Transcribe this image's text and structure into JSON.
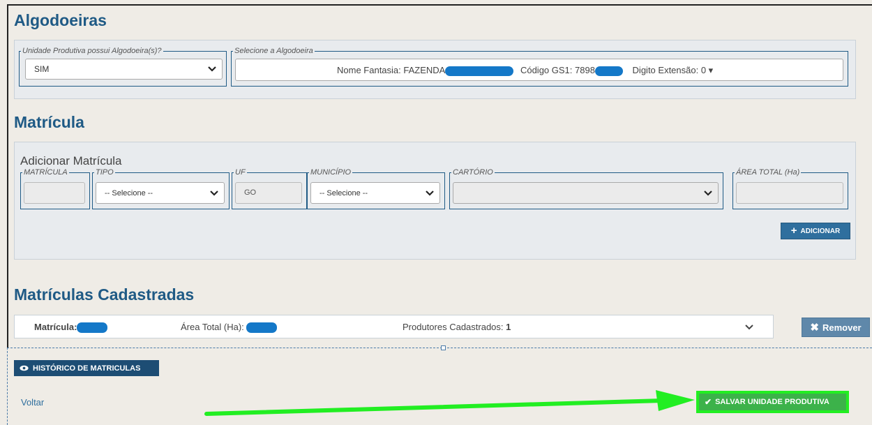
{
  "sections": {
    "algodoeiras": "Algodoeiras",
    "matricula": "Matrícula",
    "cadastradas": "Matrículas Cadastradas"
  },
  "algodoeira": {
    "unidade_legend": "Unidade Produtiva possui Algodoeira(s)?",
    "unidade_value": "SIM",
    "select_legend": "Selecione a Algodoeira",
    "nome_fantasia_label": "Nome Fantasia: FAZENDA",
    "codigo_label": "Código GS1: 7898",
    "digito_label": "Digito Extensão: 0 ▾"
  },
  "add_matricula": {
    "title": "Adicionar Matrícula",
    "matricula_legend": "MATRÍCULA",
    "tipo_legend": "TIPO",
    "tipo_value": "-- Selecione --",
    "uf_legend": "UF",
    "uf_value": "GO",
    "municipio_legend": "MUNICÍPIO",
    "municipio_value": "-- Selecione --",
    "cartorio_legend": "CARTÓRIO",
    "area_legend": "ÁREA TOTAL (Ha)",
    "adicionar_label": "ADICIONAR"
  },
  "cadastrada": {
    "matricula_label": "Matrícula:",
    "area_label": "Área Total (Ha):",
    "produtores_label": "Produtores Cadastrados:",
    "produtores_value": "1",
    "remover_label": "Remover"
  },
  "footer": {
    "historico_label": "HISTÓRICO DE MATRICULAS",
    "voltar_label": "Voltar",
    "salvar_label": "SALVAR UNIDADE PRODUTIVA"
  },
  "colors": {
    "heading": "#1f5a85",
    "redaction": "#1478c8",
    "arrow": "#22ee22",
    "save_button": "#3cb24a"
  }
}
